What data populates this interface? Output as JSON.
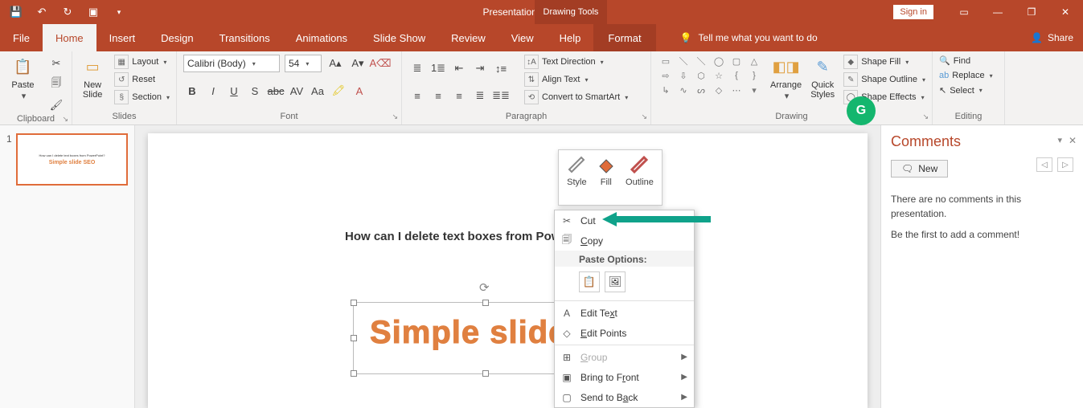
{
  "title": "Presentation1 - PowerPoint",
  "contextual_tab_group": "Drawing Tools",
  "signin": "Sign in",
  "tabs": {
    "file": "File",
    "home": "Home",
    "insert": "Insert",
    "design": "Design",
    "transitions": "Transitions",
    "animations": "Animations",
    "slideshow": "Slide Show",
    "review": "Review",
    "view": "View",
    "help": "Help",
    "format": "Format",
    "tell": "Tell me what you want to do",
    "share": "Share"
  },
  "ribbon": {
    "clipboard": {
      "label": "Clipboard",
      "paste": "Paste"
    },
    "slides": {
      "label": "Slides",
      "new": "New\nSlide",
      "layout": "Layout",
      "reset": "Reset",
      "section": "Section"
    },
    "font": {
      "label": "Font",
      "name": "Calibri (Body)",
      "size": "54"
    },
    "paragraph": {
      "label": "Paragraph",
      "textdir": "Text Direction",
      "align": "Align Text",
      "smartart": "Convert to SmartArt"
    },
    "drawing": {
      "label": "Drawing",
      "arrange": "Arrange",
      "quick": "Quick\nStyles",
      "fill": "Shape Fill",
      "outline": "Shape Outline",
      "effects": "Shape Effects"
    },
    "editing": {
      "label": "Editing",
      "find": "Find",
      "replace": "Replace",
      "select": "Select"
    }
  },
  "minitb": {
    "style": "Style",
    "fill": "Fill",
    "outline": "Outline"
  },
  "slide": {
    "title_text": "How can I delete text boxes from Powe",
    "wordart_text": "Simple slide"
  },
  "context": {
    "cut": "Cut",
    "copy": "Copy",
    "paste_options": "Paste Options:",
    "edit_text": "Edit Text",
    "edit_points": "Edit Points",
    "group": "Group",
    "bring_front": "Bring to Front",
    "send_back": "Send to Back"
  },
  "comments": {
    "heading": "Comments",
    "new": "New",
    "empty1": "There are no comments in this presentation.",
    "empty2": "Be the first to add a comment!"
  },
  "thumb": {
    "num": "1"
  },
  "chart_data": null
}
